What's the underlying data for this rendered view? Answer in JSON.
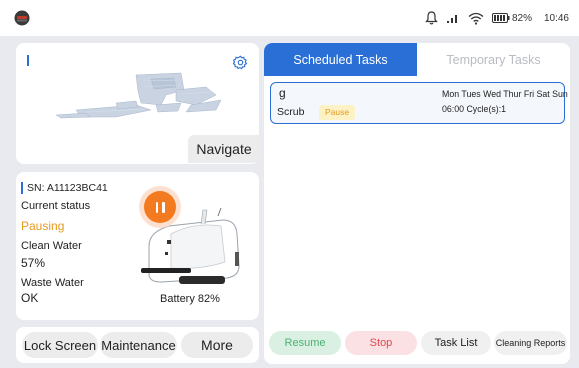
{
  "status_bar": {
    "battery_text": "82%",
    "time": "10:46",
    "icons": [
      "app-icon",
      "bell-icon",
      "signal-icon",
      "wifi-icon",
      "battery-icon"
    ]
  },
  "map_card": {
    "navigate_label": "Navigate",
    "settings_icon": "gear-icon"
  },
  "robot": {
    "sn": "SN: A11123BC41",
    "current_status_label": "Current status",
    "current_status_value": "Pausing",
    "clean_water_label": "Clean Water",
    "clean_water_value": "57%",
    "waste_water_label": "Waste Water",
    "waste_water_value": "OK",
    "battery": "Battery 82%"
  },
  "bottom_buttons": {
    "lock_screen": "Lock Screen",
    "maintenance": "Maintenance",
    "more": "More"
  },
  "tabs": {
    "scheduled": "Scheduled Tasks",
    "temporary": "Temporary Tasks",
    "active": "scheduled"
  },
  "tasks": [
    {
      "name": "g",
      "mode": "Scrub",
      "status": "Pause",
      "days": "Mon Tues Wed Thur Fri Sat Sun",
      "schedule": "06:00 Cycle(s):1"
    }
  ],
  "actions": {
    "resume": "Resume",
    "stop": "Stop",
    "task_list": "Task List",
    "cleaning_reports": "Cleaning Reports"
  },
  "colors": {
    "accent": "#2a6fd6",
    "pause_orange": "#f47a20",
    "status_orange": "#e69a1e",
    "resume_green": "#4bb272",
    "stop_red": "#e2474f",
    "background": "#e9eaef"
  }
}
